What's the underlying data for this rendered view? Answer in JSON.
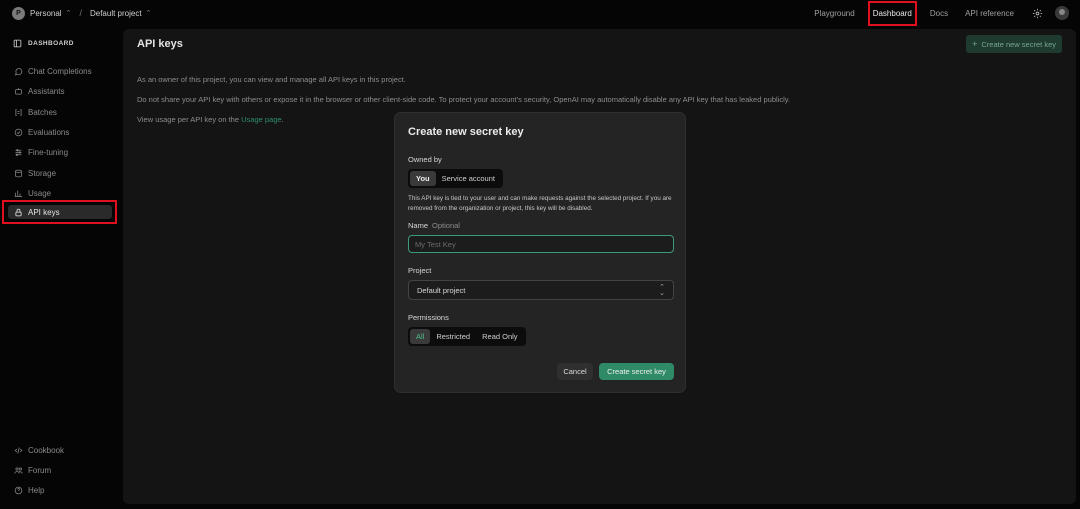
{
  "topbar": {
    "org_initial": "P",
    "org_name": "Personal",
    "separator": "/",
    "project_name": "Default project",
    "nav": {
      "playground": "Playground",
      "dashboard": "Dashboard",
      "docs": "Docs",
      "api_reference": "API reference"
    },
    "settings_icon": "gear-icon",
    "avatar_icon": "user-avatar"
  },
  "sidebar": {
    "heading": "DASHBOARD",
    "items": [
      {
        "label": "Chat Completions",
        "icon": "chat-icon"
      },
      {
        "label": "Assistants",
        "icon": "assistant-icon"
      },
      {
        "label": "Batches",
        "icon": "batches-icon"
      },
      {
        "label": "Evaluations",
        "icon": "evaluations-icon"
      },
      {
        "label": "Fine-tuning",
        "icon": "fine-tuning-icon"
      },
      {
        "label": "Storage",
        "icon": "storage-icon"
      },
      {
        "label": "Usage",
        "icon": "usage-icon"
      },
      {
        "label": "API keys",
        "icon": "lock-icon"
      }
    ],
    "footer": [
      {
        "label": "Cookbook",
        "icon": "code-icon"
      },
      {
        "label": "Forum",
        "icon": "people-icon"
      },
      {
        "label": "Help",
        "icon": "help-icon"
      }
    ]
  },
  "main": {
    "title": "API keys",
    "create_button": "Create new secret key",
    "para1": "As an owner of this project, you can view and manage all API keys in this project.",
    "para2": "Do not share your API key with others or expose it in the browser or other client-side code. To protect your account's security, OpenAI may automatically disable any API key that has leaked publicly.",
    "para3_prefix": "View usage per API key on the ",
    "para3_link": "Usage page",
    "para3_suffix": "."
  },
  "modal": {
    "title": "Create new secret key",
    "owned_by_label": "Owned by",
    "owned_by_options": [
      "You",
      "Service account"
    ],
    "owned_by_selected": "You",
    "description": "This API key is tied to your user and can make requests against the selected project. If you are removed from the organization or project, this key will be disabled.",
    "name_label": "Name",
    "name_optional": "Optional",
    "name_placeholder": "My Test Key",
    "name_value": "",
    "project_label": "Project",
    "project_value": "Default project",
    "permissions_label": "Permissions",
    "permissions_options": [
      "All",
      "Restricted",
      "Read Only"
    ],
    "permissions_selected": "All",
    "cancel": "Cancel",
    "submit": "Create secret key"
  },
  "colors": {
    "accent_green": "#2f8a68",
    "highlight_red": "#e0101f"
  }
}
